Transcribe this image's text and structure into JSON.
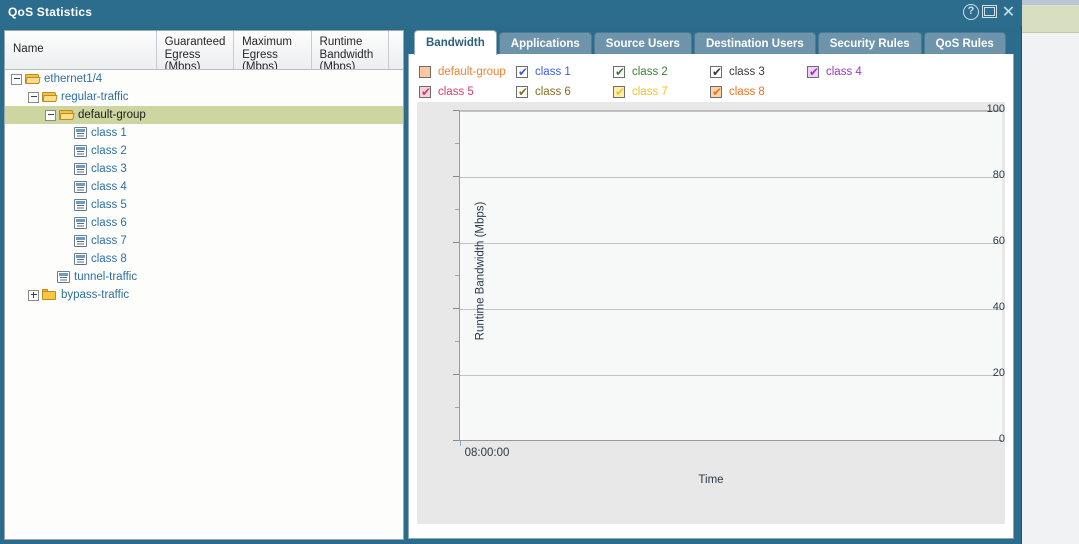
{
  "window": {
    "title": "QoS Statistics",
    "controls": [
      {
        "name": "help-button",
        "glyph": "?"
      },
      {
        "name": "maximize-button",
        "glyph": ""
      },
      {
        "name": "close-button",
        "glyph": "✕"
      }
    ]
  },
  "tree_table": {
    "columns": [
      {
        "key": "name",
        "label": "Name"
      },
      {
        "key": "guaranteed_egress",
        "label": "Guaranteed\nEgress\n(Mbps)"
      },
      {
        "key": "maximum_egress",
        "label": "Maximum\nEgress\n(Mbps)"
      },
      {
        "key": "runtime_bandwidth",
        "label": "Runtime\nBandwidth\n(Mbps)"
      }
    ],
    "rows": [
      {
        "label": "ethernet1/4",
        "depth": 0,
        "type": "folder-open",
        "expander": "minus",
        "selected": false
      },
      {
        "label": "regular-traffic",
        "depth": 1,
        "type": "folder-open",
        "expander": "minus",
        "selected": false
      },
      {
        "label": "default-group",
        "depth": 2,
        "type": "folder-open",
        "expander": "minus",
        "selected": true
      },
      {
        "label": "class 1",
        "depth": 3,
        "type": "leaf",
        "expander": "none",
        "selected": false
      },
      {
        "label": "class 2",
        "depth": 3,
        "type": "leaf",
        "expander": "none",
        "selected": false
      },
      {
        "label": "class 3",
        "depth": 3,
        "type": "leaf",
        "expander": "none",
        "selected": false
      },
      {
        "label": "class 4",
        "depth": 3,
        "type": "leaf",
        "expander": "none",
        "selected": false
      },
      {
        "label": "class 5",
        "depth": 3,
        "type": "leaf",
        "expander": "none",
        "selected": false
      },
      {
        "label": "class 6",
        "depth": 3,
        "type": "leaf",
        "expander": "none",
        "selected": false
      },
      {
        "label": "class 7",
        "depth": 3,
        "type": "leaf",
        "expander": "none",
        "selected": false
      },
      {
        "label": "class 8",
        "depth": 3,
        "type": "leaf",
        "expander": "none",
        "selected": false
      },
      {
        "label": "tunnel-traffic",
        "depth": 2,
        "type": "leaf",
        "expander": "none",
        "selected": false
      },
      {
        "label": "bypass-traffic",
        "depth": 1,
        "type": "folder-closed",
        "expander": "plus",
        "selected": false
      }
    ]
  },
  "tabs": [
    {
      "label": "Bandwidth",
      "active": true
    },
    {
      "label": "Applications",
      "active": false
    },
    {
      "label": "Source Users",
      "active": false
    },
    {
      "label": "Destination Users",
      "active": false
    },
    {
      "label": "Security Rules",
      "active": false
    },
    {
      "label": "QoS Rules",
      "active": false
    }
  ],
  "legend": [
    {
      "label": "default-group",
      "color": "#f57f2c",
      "box_fill": "#fbc9a0",
      "checked": false
    },
    {
      "label": "class 1",
      "color": "#3a5fe0",
      "box_fill": "#ffffff",
      "checked": true
    },
    {
      "label": "class 2",
      "color": "#3f7d32",
      "box_fill": "#ffffff",
      "checked": true
    },
    {
      "label": "class 3",
      "color": "#3a3a3a",
      "box_fill": "#ffffff",
      "checked": true
    },
    {
      "label": "class 4",
      "color": "#9b36c6",
      "box_fill": "#f0d2f7",
      "checked": true
    },
    {
      "label": "class 5",
      "color": "#d63a6e",
      "box_fill": "#f8d3df",
      "checked": true
    },
    {
      "label": "class 6",
      "color": "#8a6a1f",
      "box_fill": "#ffffff",
      "checked": true
    },
    {
      "label": "class 7",
      "color": "#f2c422",
      "box_fill": "#fdf0b0",
      "checked": true
    },
    {
      "label": "class 8",
      "color": "#f07020",
      "box_fill": "#fbd3ae",
      "checked": true
    }
  ],
  "chart_data": {
    "type": "line",
    "title": "",
    "xlabel": "Time",
    "ylabel": "Runtime Bandwidth (Mbps)",
    "ylim": [
      0,
      100
    ],
    "yticks": [
      0,
      20,
      40,
      60,
      80,
      100
    ],
    "yminorticks": [
      10,
      30,
      50,
      70,
      90
    ],
    "xticks": [
      "08:00:00"
    ],
    "grid": "horizontal-major-only",
    "legend_position": "top",
    "series": [
      {
        "name": "default-group",
        "values": []
      },
      {
        "name": "class 1",
        "values": []
      },
      {
        "name": "class 2",
        "values": []
      },
      {
        "name": "class 3",
        "values": []
      },
      {
        "name": "class 4",
        "values": []
      },
      {
        "name": "class 5",
        "values": []
      },
      {
        "name": "class 6",
        "values": []
      },
      {
        "name": "class 7",
        "values": []
      },
      {
        "name": "class 8",
        "values": []
      }
    ]
  }
}
